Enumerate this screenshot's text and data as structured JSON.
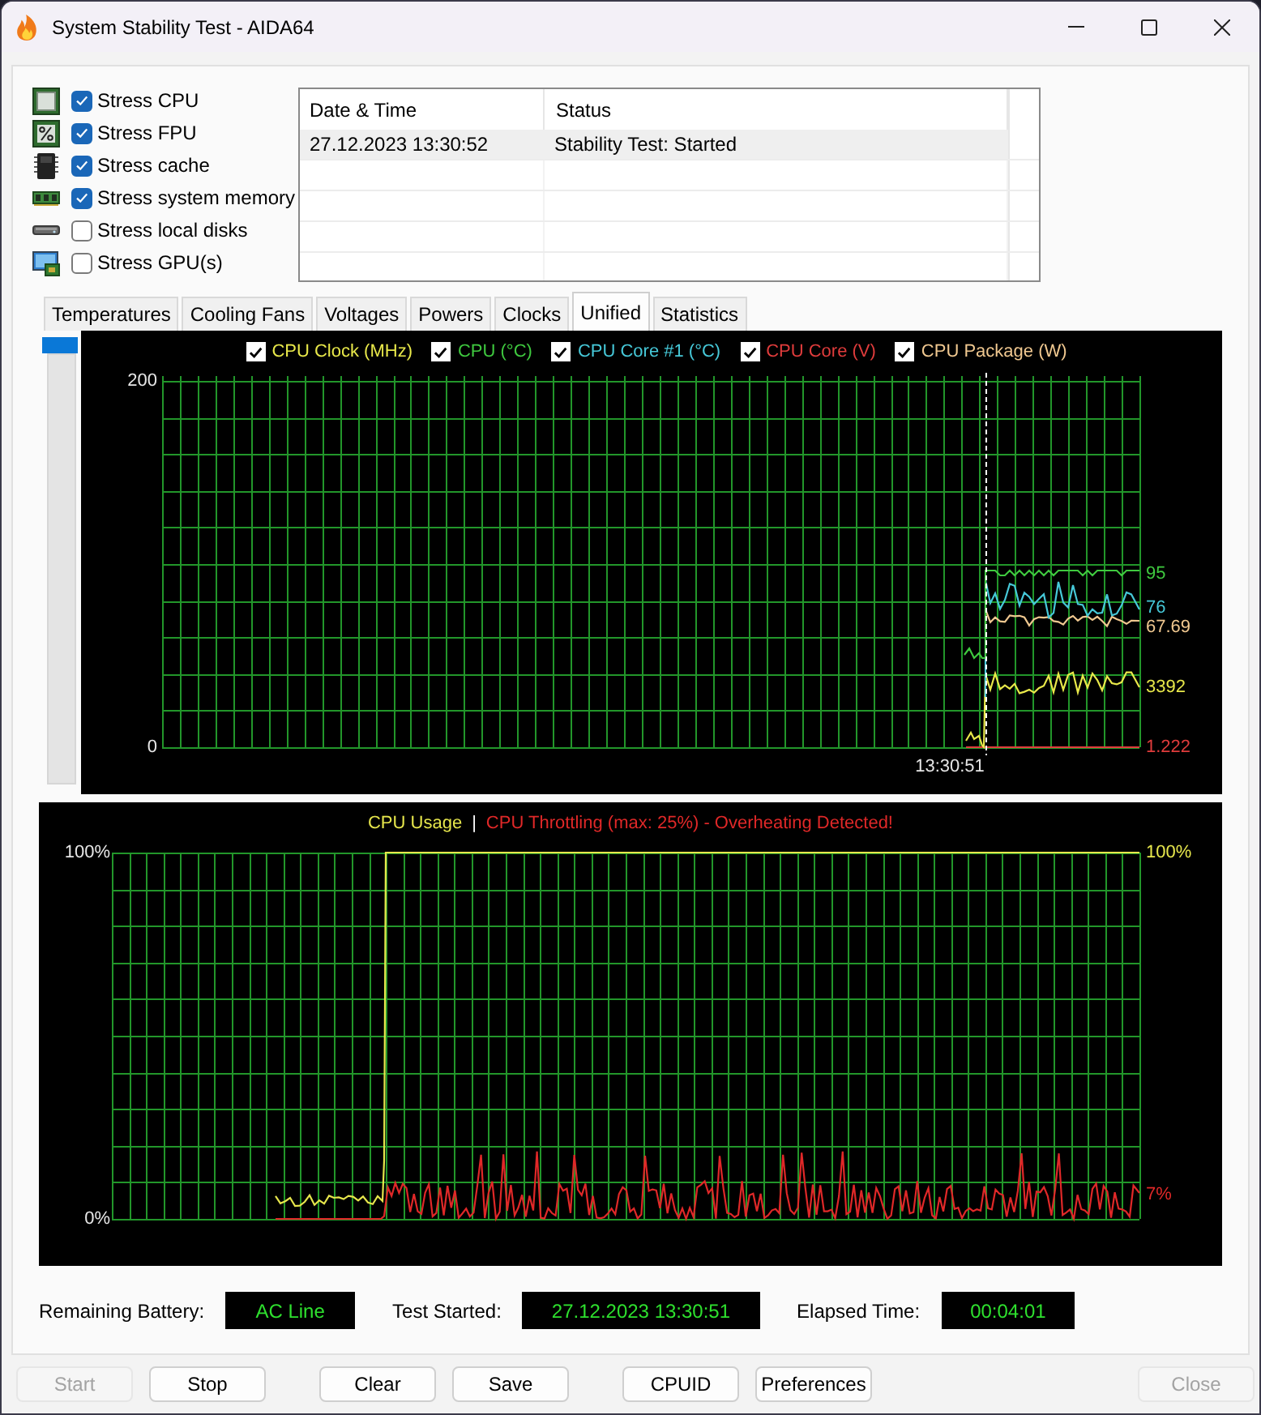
{
  "window": {
    "title": "System Stability Test - AIDA64"
  },
  "stress_options": [
    {
      "label": "Stress CPU",
      "checked": true
    },
    {
      "label": "Stress FPU",
      "checked": true
    },
    {
      "label": "Stress cache",
      "checked": true
    },
    {
      "label": "Stress system memory",
      "checked": true
    },
    {
      "label": "Stress local disks",
      "checked": false
    },
    {
      "label": "Stress GPU(s)",
      "checked": false
    }
  ],
  "log_table": {
    "columns": [
      "Date & Time",
      "Status"
    ],
    "rows": [
      {
        "cells": [
          "27.12.2023 13:30:52",
          "Stability Test: Started"
        ],
        "selected": true
      }
    ]
  },
  "tabs": [
    {
      "label": "Temperatures",
      "selected": false
    },
    {
      "label": "Cooling Fans",
      "selected": false
    },
    {
      "label": "Voltages",
      "selected": false
    },
    {
      "label": "Powers",
      "selected": false
    },
    {
      "label": "Clocks",
      "selected": false
    },
    {
      "label": "Unified",
      "selected": true
    },
    {
      "label": "Statistics",
      "selected": false
    }
  ],
  "sensor_chart": {
    "legend": [
      {
        "label": "CPU Clock (MHz)",
        "checked": true,
        "color": "#e8e84a"
      },
      {
        "label": "CPU (°C)",
        "checked": true,
        "color": "#3fc93f"
      },
      {
        "label": "CPU Core #1 (°C)",
        "checked": true,
        "color": "#46c8d8"
      },
      {
        "label": "CPU Core (V)",
        "checked": true,
        "color": "#e03c3c"
      },
      {
        "label": "CPU Package (W)",
        "checked": true,
        "color": "#f0c890"
      }
    ],
    "y_max": "200",
    "y_min": "0",
    "time_label": "13:30:51",
    "readings": [
      {
        "value": "95",
        "color": "#3fc93f"
      },
      {
        "value": "76",
        "color": "#46c8d8"
      },
      {
        "value": "67.69",
        "color": "#f0c890"
      },
      {
        "value": "3392",
        "color": "#e8e84a"
      },
      {
        "value": "1.222",
        "color": "#e03c3c"
      }
    ]
  },
  "usage_chart": {
    "series": [
      {
        "label": "CPU Usage",
        "color": "#e6e64c",
        "reading": "100%"
      },
      {
        "label": "CPU Throttling (max: 25%) - Overheating Detected!",
        "color": "#e02828",
        "reading": "7%"
      }
    ],
    "separator": "|",
    "y_max": "100%",
    "y_min": "0%"
  },
  "status_fields": [
    {
      "label": "Remaining Battery:",
      "value": "AC Line"
    },
    {
      "label": "Test Started:",
      "value": "27.12.2023 13:30:51"
    },
    {
      "label": "Elapsed Time:",
      "value": "00:04:01"
    }
  ],
  "button_groups": [
    [
      {
        "label": "Start",
        "disabled": true
      },
      {
        "label": "Stop",
        "disabled": false
      }
    ],
    [
      {
        "label": "Clear",
        "disabled": false
      },
      {
        "label": "Save",
        "disabled": false
      }
    ],
    [
      {
        "label": "CPUID",
        "disabled": false
      },
      {
        "label": "Preferences",
        "disabled": false
      }
    ],
    [
      {
        "label": "Close",
        "disabled": true
      }
    ]
  ]
}
